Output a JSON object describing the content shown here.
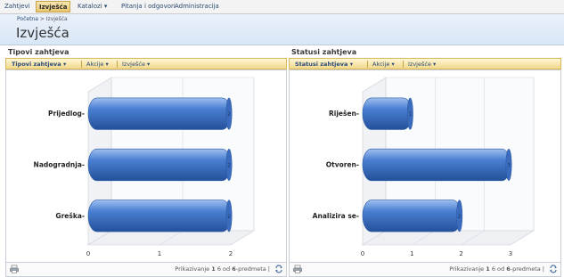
{
  "nav": {
    "tabs": [
      {
        "label": "Zahtjevi",
        "active": false
      },
      {
        "label": "Izvješća",
        "active": true
      },
      {
        "label": "Katalozi",
        "dropdown": true
      },
      {
        "label": "Pitanja i odgovori",
        "active": false
      },
      {
        "label": "Administracija",
        "active": false
      }
    ]
  },
  "breadcrumb": {
    "root": "Početna",
    "sep": ">",
    "current": "Izvješća"
  },
  "page_title": "Izvješća",
  "panels": [
    {
      "title": "Tipovi zahtjeva",
      "toolbar": [
        "Tipovi zahtjeva",
        "Akcije",
        "Izvješće"
      ],
      "pager": {
        "prefix": "Prikazivanje ",
        "from": "1",
        "mid": " 6 od ",
        "total": "6",
        "suffix": "-predmeta |"
      }
    },
    {
      "title": "Statusi zahtjeva",
      "toolbar": [
        "Statusi zahtjeva",
        "Akcije",
        "Izvješće"
      ],
      "pager": {
        "prefix": "Prikazivanje ",
        "from": "1",
        "mid": " 6 od ",
        "total": "6",
        "suffix": "-predmeta |"
      }
    }
  ],
  "chart_data": [
    {
      "type": "bar",
      "orientation": "horizontal",
      "style": "3d-cylinder",
      "categories": [
        "Prijedlog",
        "Nadogradnja",
        "Greška"
      ],
      "values": [
        2,
        2,
        2
      ],
      "data_labels": [
        "2",
        "2",
        "2"
      ],
      "x_ticks": [
        "0",
        "1",
        "2"
      ],
      "xlim": [
        0,
        2
      ],
      "bar_color": "#4a7fd1",
      "grid": true
    },
    {
      "type": "bar",
      "orientation": "horizontal",
      "style": "3d-cylinder",
      "categories": [
        "Riješen",
        "Otvoren",
        "Analizira se"
      ],
      "values": [
        1,
        3,
        2
      ],
      "data_labels": [
        "1",
        "3",
        "2"
      ],
      "x_ticks": [
        "0",
        "1",
        "2",
        "3"
      ],
      "xlim": [
        0,
        3
      ],
      "bar_color": "#4a7fd1",
      "grid": true
    }
  ]
}
